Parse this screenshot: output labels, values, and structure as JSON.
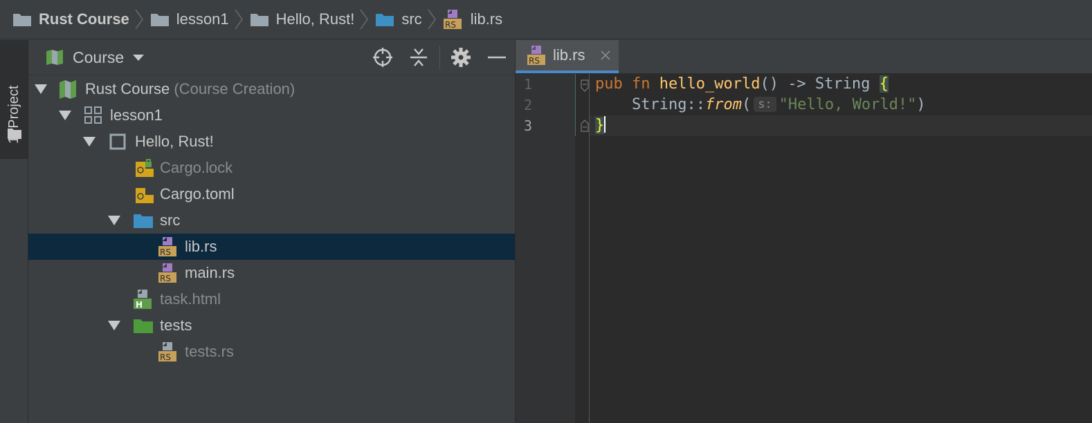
{
  "breadcrumb": {
    "items": [
      {
        "label": "Rust Course",
        "icon": "folder-icon"
      },
      {
        "label": "lesson1",
        "icon": "folder-icon"
      },
      {
        "label": "Hello, Rust!",
        "icon": "folder-icon"
      },
      {
        "label": "src",
        "icon": "source-folder-icon"
      },
      {
        "label": "lib.rs",
        "icon": "rust-file-icon"
      }
    ]
  },
  "side_strip": {
    "tab_label": "1: Project"
  },
  "project_panel": {
    "view_label": "Course",
    "tools": [
      "locate-icon",
      "collapse-all-icon",
      "gear-icon",
      "minimize-icon"
    ],
    "tree": [
      {
        "label": "Rust Course",
        "suffix": "(Course Creation)",
        "icon": "course-icon"
      },
      {
        "label": "lesson1",
        "icon": "lesson-icon"
      },
      {
        "label": "Hello, Rust!",
        "icon": "task-icon"
      },
      {
        "label": "Cargo.lock",
        "icon": "cargo-lock-icon"
      },
      {
        "label": "Cargo.toml",
        "icon": "cargo-toml-icon"
      },
      {
        "label": "src",
        "icon": "source-folder-icon"
      },
      {
        "label": "lib.rs",
        "icon": "rust-file-icon",
        "selected": true
      },
      {
        "label": "main.rs",
        "icon": "rust-file-icon"
      },
      {
        "label": "task.html",
        "icon": "html-file-icon"
      },
      {
        "label": "tests",
        "icon": "test-folder-icon"
      },
      {
        "label": "tests.rs",
        "icon": "rust-file-icon"
      }
    ]
  },
  "editor": {
    "tab_label": "lib.rs",
    "line_numbers": [
      "1",
      "2",
      "3"
    ],
    "code": {
      "l1_kw_pub": "pub",
      "l1_kw_fn": "fn",
      "l1_name": "hello_world",
      "l1_rest": "() -> String ",
      "l1_brace": "{",
      "l2_indent": "    String::",
      "l2_from": "from",
      "l2_paren": "(",
      "l2_hint": "s:",
      "l2_str": "\"Hello, World!\"",
      "l2_close": ")",
      "l3_brace": "}"
    }
  },
  "colors": {
    "background": "#3c3f41",
    "editor_bg": "#2b2b2b",
    "selection": "#0d293e",
    "keyword": "#cc7832",
    "function": "#ffc66d",
    "string": "#6a8759",
    "tab_underline": "#4a88c7"
  }
}
